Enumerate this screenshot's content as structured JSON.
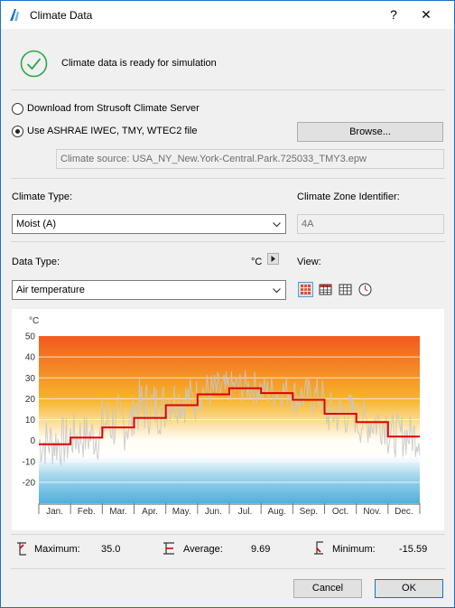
{
  "window": {
    "title": "Climate Data",
    "help": "?",
    "close": "✕"
  },
  "status": {
    "message": "Climate data is ready for simulation"
  },
  "source": {
    "option_download": "Download from Strusoft Climate Server",
    "option_file": "Use ASHRAE IWEC, TMY, WTEC2 file",
    "selected": "file",
    "browse_label": "Browse...",
    "source_path": "Climate source: USA_NY_New.York-Central.Park.725033_TMY3.epw"
  },
  "climate": {
    "type_label": "Climate Type:",
    "type_value": "Moist (A)",
    "zone_label": "Climate Zone Identifier:",
    "zone_value": "4A"
  },
  "data": {
    "type_label": "Data Type:",
    "unit": "°C",
    "type_value": "Air temperature",
    "view_label": "View:"
  },
  "chart_data": {
    "type": "line",
    "ylabel": "°C",
    "ylim": [
      -30,
      50
    ],
    "yticks": [
      "50",
      "40",
      "30",
      "20",
      "10",
      "0",
      "-10",
      "-20"
    ],
    "categories": [
      "Jan.",
      "Feb.",
      "Mar.",
      "Apr.",
      "May.",
      "Jun.",
      "Jul.",
      "Aug.",
      "Sep.",
      "Oct.",
      "Nov.",
      "Dec."
    ],
    "series": [
      {
        "kind": "monthly-average",
        "color": "#e00000",
        "values": [
          -1.8,
          1.4,
          6.3,
          10.8,
          16.9,
          22.1,
          25.0,
          22.7,
          19.5,
          12.8,
          8.8,
          1.9
        ]
      },
      {
        "kind": "hourly-range",
        "color": "#c8c8c8",
        "min": [
          -15.6,
          -12,
          -8,
          0,
          6,
          12,
          16,
          14,
          10,
          0,
          -4,
          -10
        ],
        "max": [
          14,
          16,
          25,
          32,
          33,
          35,
          35,
          33,
          32,
          26,
          22,
          15
        ]
      }
    ]
  },
  "stats": {
    "max_label": "Maximum:",
    "max_value": "35.0",
    "avg_label": "Average:",
    "avg_value": "9.69",
    "min_label": "Minimum:",
    "min_value": "-15.59"
  },
  "buttons": {
    "cancel": "Cancel",
    "ok": "OK"
  }
}
